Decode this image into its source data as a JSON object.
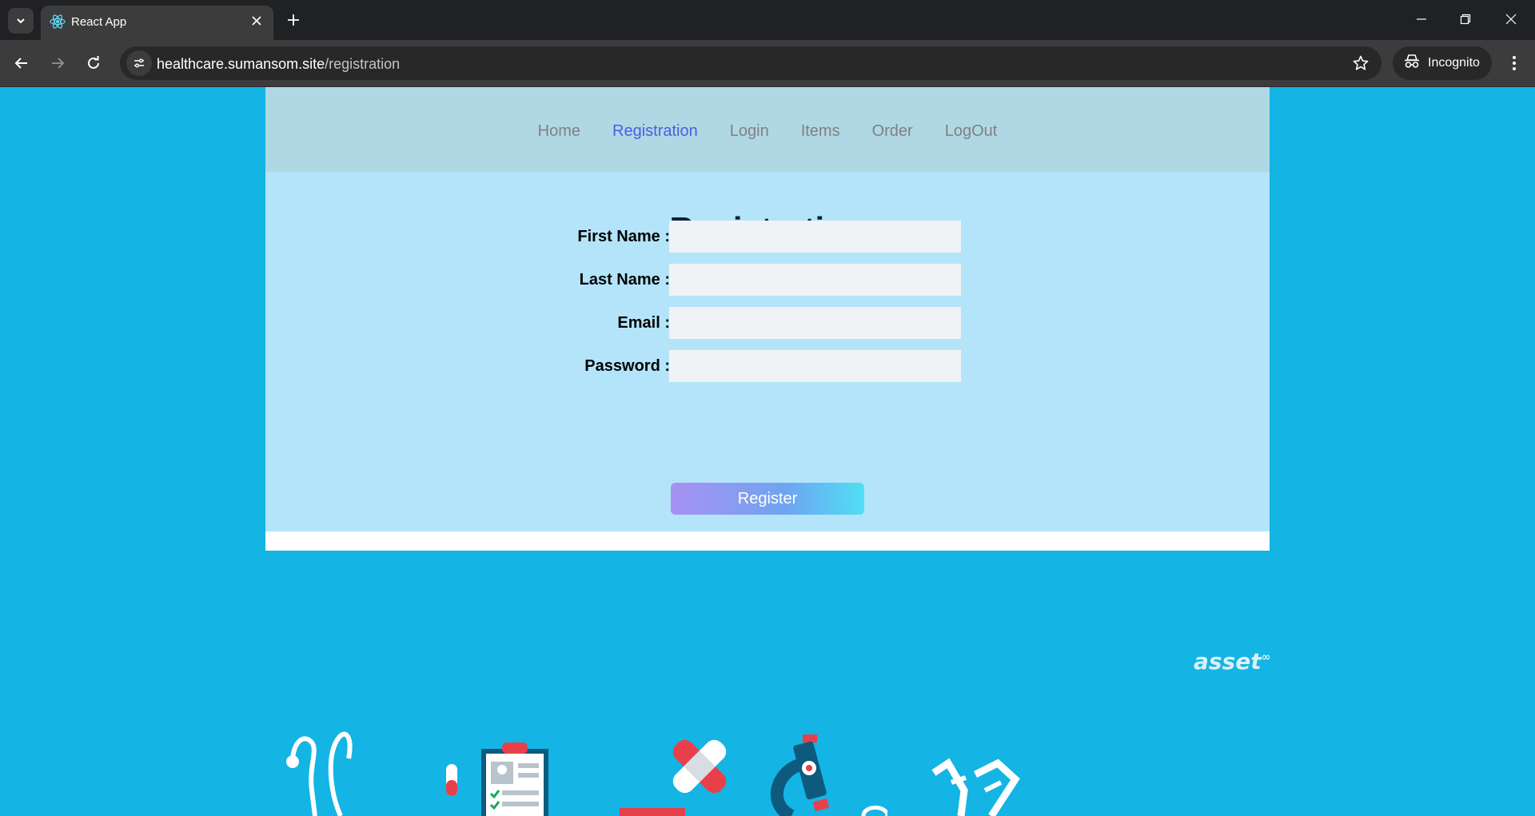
{
  "browser": {
    "tab_title": "React App",
    "url_host": "healthcare.sumansom.site",
    "url_path": "/registration",
    "incognito_label": "Incognito",
    "icons": [
      "tab-search-icon",
      "react-favicon-icon",
      "close-icon",
      "plus-icon",
      "minimize-icon",
      "restore-icon",
      "window-close-icon",
      "back-arrow-icon",
      "forward-arrow-icon",
      "reload-icon",
      "site-info-icon",
      "star-icon",
      "incognito-icon",
      "kebab-menu-icon"
    ]
  },
  "nav": {
    "items": [
      {
        "label": "Home",
        "active": false
      },
      {
        "label": "Registration",
        "active": true
      },
      {
        "label": "Login",
        "active": false
      },
      {
        "label": "Items",
        "active": false
      },
      {
        "label": "Order",
        "active": false
      },
      {
        "label": "LogOut",
        "active": false
      }
    ]
  },
  "form": {
    "title": "Registration",
    "fields": [
      {
        "label": "First Name :",
        "value": "",
        "type": "text"
      },
      {
        "label": "Last Name :",
        "value": "",
        "type": "text"
      },
      {
        "label": "Email :",
        "value": "",
        "type": "email"
      },
      {
        "label": "Password :",
        "value": "",
        "type": "password"
      }
    ],
    "submit_label": "Register"
  },
  "background": {
    "watermark": "asset",
    "watermark_sup": "∞"
  },
  "colors": {
    "page_background": "#14b4e4",
    "navbar_background": "#b0d8e4",
    "form_background": "#b4e4fa",
    "active_link": "#4a5ee0",
    "title": "#0b1f3a"
  }
}
